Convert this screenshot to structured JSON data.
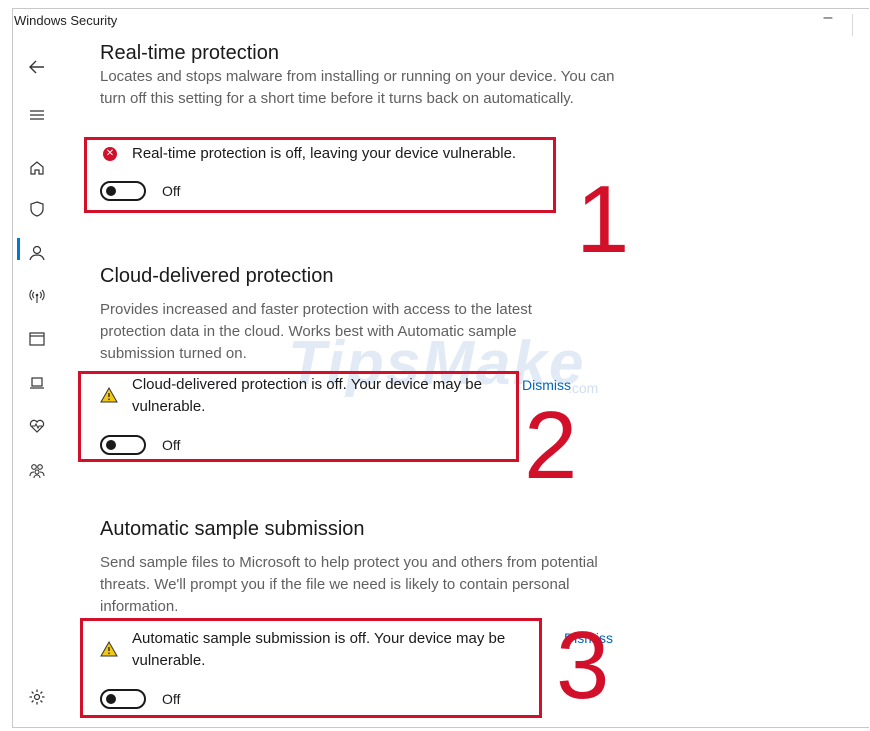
{
  "window": {
    "title": "Windows Security",
    "minimize": "–"
  },
  "nav": {
    "back": "back-arrow-icon",
    "menu": "hamburger-icon",
    "items": [
      "home-icon",
      "shield-icon",
      "person-icon",
      "wireless-icon",
      "app-browser-icon",
      "device-icon",
      "health-heart-icon",
      "family-icon"
    ],
    "settings": "gear-icon",
    "accent": "#0078d4"
  },
  "watermark": {
    "text": "TipsMake",
    "suffix": ".com"
  },
  "sections": [
    {
      "title": "Real-time protection",
      "description": "Locates and stops malware from installing or running on your device. You can turn off this setting for a short time before it turns back on automatically.",
      "status": "Real-time protection is off, leaving your device vulnerable.",
      "status_type": "error",
      "toggle": "Off",
      "number": "1"
    },
    {
      "title": "Cloud-delivered protection",
      "description": "Provides increased and faster protection with access to the latest protection data in the cloud. Works best with Automatic sample submission turned on.",
      "status": "Cloud-delivered protection is off. Your device may be vulnerable.",
      "status_type": "warning",
      "dismiss": "Dismiss",
      "toggle": "Off",
      "number": "2"
    },
    {
      "title": "Automatic sample submission",
      "description": "Send sample files to Microsoft to help protect you and others from potential threats. We'll prompt you if the file we need is likely to contain personal information.",
      "status": "Automatic sample submission is off. Your device may be vulnerable.",
      "status_type": "warning",
      "dismiss": "Dismiss",
      "toggle": "Off",
      "number": "3"
    }
  ],
  "colors": {
    "annotation_red": "#d3102a",
    "link_blue": "#0067b8",
    "warning_yellow": "#f2c811"
  }
}
